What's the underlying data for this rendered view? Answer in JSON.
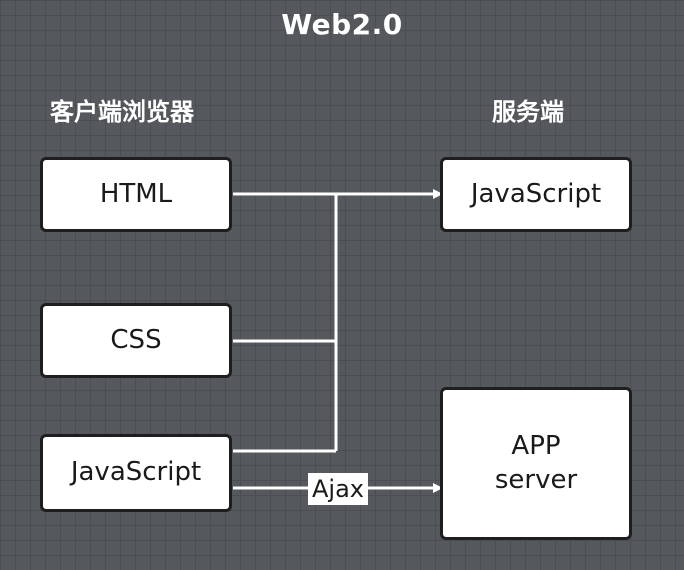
{
  "title": "Web2.0",
  "headings": {
    "client": "客户端浏览器",
    "server": "服务端"
  },
  "client_boxes": {
    "html": "HTML",
    "css": "CSS",
    "javascript": "JavaScript"
  },
  "server_boxes": {
    "javascript": "JavaScript",
    "app_line1": "APP",
    "app_line2": "server"
  },
  "edge_label": "Ajax",
  "colors": {
    "background": "#55595e",
    "grid": "#4a4e52",
    "node_fill": "#ffffff",
    "node_border": "#1e1e1e",
    "connector": "#ffffff"
  }
}
